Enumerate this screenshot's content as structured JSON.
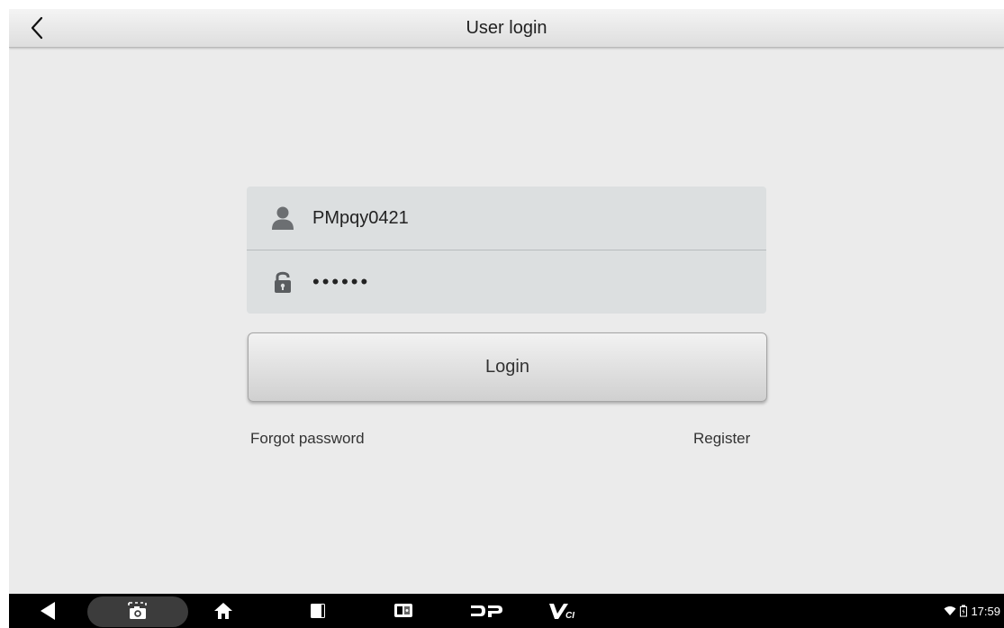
{
  "header": {
    "title": "User login",
    "back_icon": "chevron-left-icon"
  },
  "form": {
    "username": {
      "icon": "user-icon",
      "value": "PMpqy0421"
    },
    "password": {
      "icon": "unlock-icon",
      "value": "••••••"
    },
    "login_label": "Login",
    "forgot_label": "Forgot password",
    "register_label": "Register"
  },
  "navbar": {
    "items": [
      "back-triangle-icon",
      "screenshot-icon",
      "home-icon",
      "recent-apps-icon",
      "display-icon",
      "dp-logo-icon",
      "vci-icon"
    ],
    "status": {
      "wifi_icon": "wifi-icon",
      "battery_icon": "battery-icon",
      "time": "17:59"
    }
  },
  "colors": {
    "background": "#ebebeb",
    "field_bg": "#dcdfe0",
    "navbar_bg": "#000000"
  }
}
